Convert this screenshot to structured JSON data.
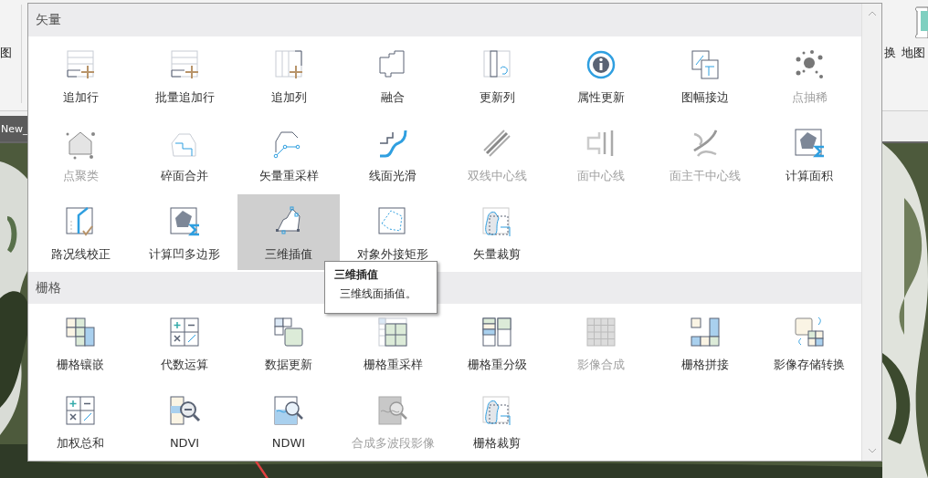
{
  "ribbon": {
    "left_label": "图",
    "right_labels": [
      "换",
      "地图"
    ]
  },
  "map_tab": {
    "label": "New_"
  },
  "panel": {
    "sections": [
      {
        "title": "矢量",
        "items": [
          {
            "label": "追加行",
            "disabled": false,
            "selected": false
          },
          {
            "label": "批量追加行",
            "disabled": false,
            "selected": false
          },
          {
            "label": "追加列",
            "disabled": false,
            "selected": false
          },
          {
            "label": "融合",
            "disabled": false,
            "selected": false
          },
          {
            "label": "更新列",
            "disabled": false,
            "selected": false
          },
          {
            "label": "属性更新",
            "disabled": false,
            "selected": false
          },
          {
            "label": "图幅接边",
            "disabled": false,
            "selected": false
          },
          {
            "label": "点抽稀",
            "disabled": true,
            "selected": false
          },
          {
            "label": "点聚类",
            "disabled": true,
            "selected": false
          },
          {
            "label": "碎面合并",
            "disabled": false,
            "selected": false
          },
          {
            "label": "矢量重采样",
            "disabled": false,
            "selected": false
          },
          {
            "label": "线面光滑",
            "disabled": false,
            "selected": false
          },
          {
            "label": "双线中心线",
            "disabled": true,
            "selected": false
          },
          {
            "label": "面中心线",
            "disabled": true,
            "selected": false
          },
          {
            "label": "面主干中心线",
            "disabled": true,
            "selected": false
          },
          {
            "label": "计算面积",
            "disabled": false,
            "selected": false
          },
          {
            "label": "路况线校正",
            "disabled": false,
            "selected": false
          },
          {
            "label": "计算凹多边形",
            "disabled": false,
            "selected": false
          },
          {
            "label": "三维插值",
            "disabled": false,
            "selected": true
          },
          {
            "label": "对象外接矩形",
            "disabled": false,
            "selected": false
          },
          {
            "label": "矢量裁剪",
            "disabled": false,
            "selected": false
          }
        ]
      },
      {
        "title": "栅格",
        "items": [
          {
            "label": "栅格镶嵌",
            "disabled": false,
            "selected": false
          },
          {
            "label": "代数运算",
            "disabled": false,
            "selected": false
          },
          {
            "label": "数据更新",
            "disabled": false,
            "selected": false
          },
          {
            "label": "栅格重采样",
            "disabled": false,
            "selected": false
          },
          {
            "label": "栅格重分级",
            "disabled": false,
            "selected": false
          },
          {
            "label": "影像合成",
            "disabled": true,
            "selected": false
          },
          {
            "label": "栅格拼接",
            "disabled": false,
            "selected": false
          },
          {
            "label": "影像存储转换",
            "disabled": false,
            "selected": false
          },
          {
            "label": "加权总和",
            "disabled": false,
            "selected": false
          },
          {
            "label": "NDVI",
            "disabled": false,
            "selected": false
          },
          {
            "label": "NDWI",
            "disabled": false,
            "selected": false
          },
          {
            "label": "合成多波段影像",
            "disabled": true,
            "selected": false
          },
          {
            "label": "栅格裁剪",
            "disabled": false,
            "selected": false
          }
        ]
      }
    ]
  },
  "tooltip": {
    "title": "三维插值",
    "description": "三维线面插值。"
  }
}
